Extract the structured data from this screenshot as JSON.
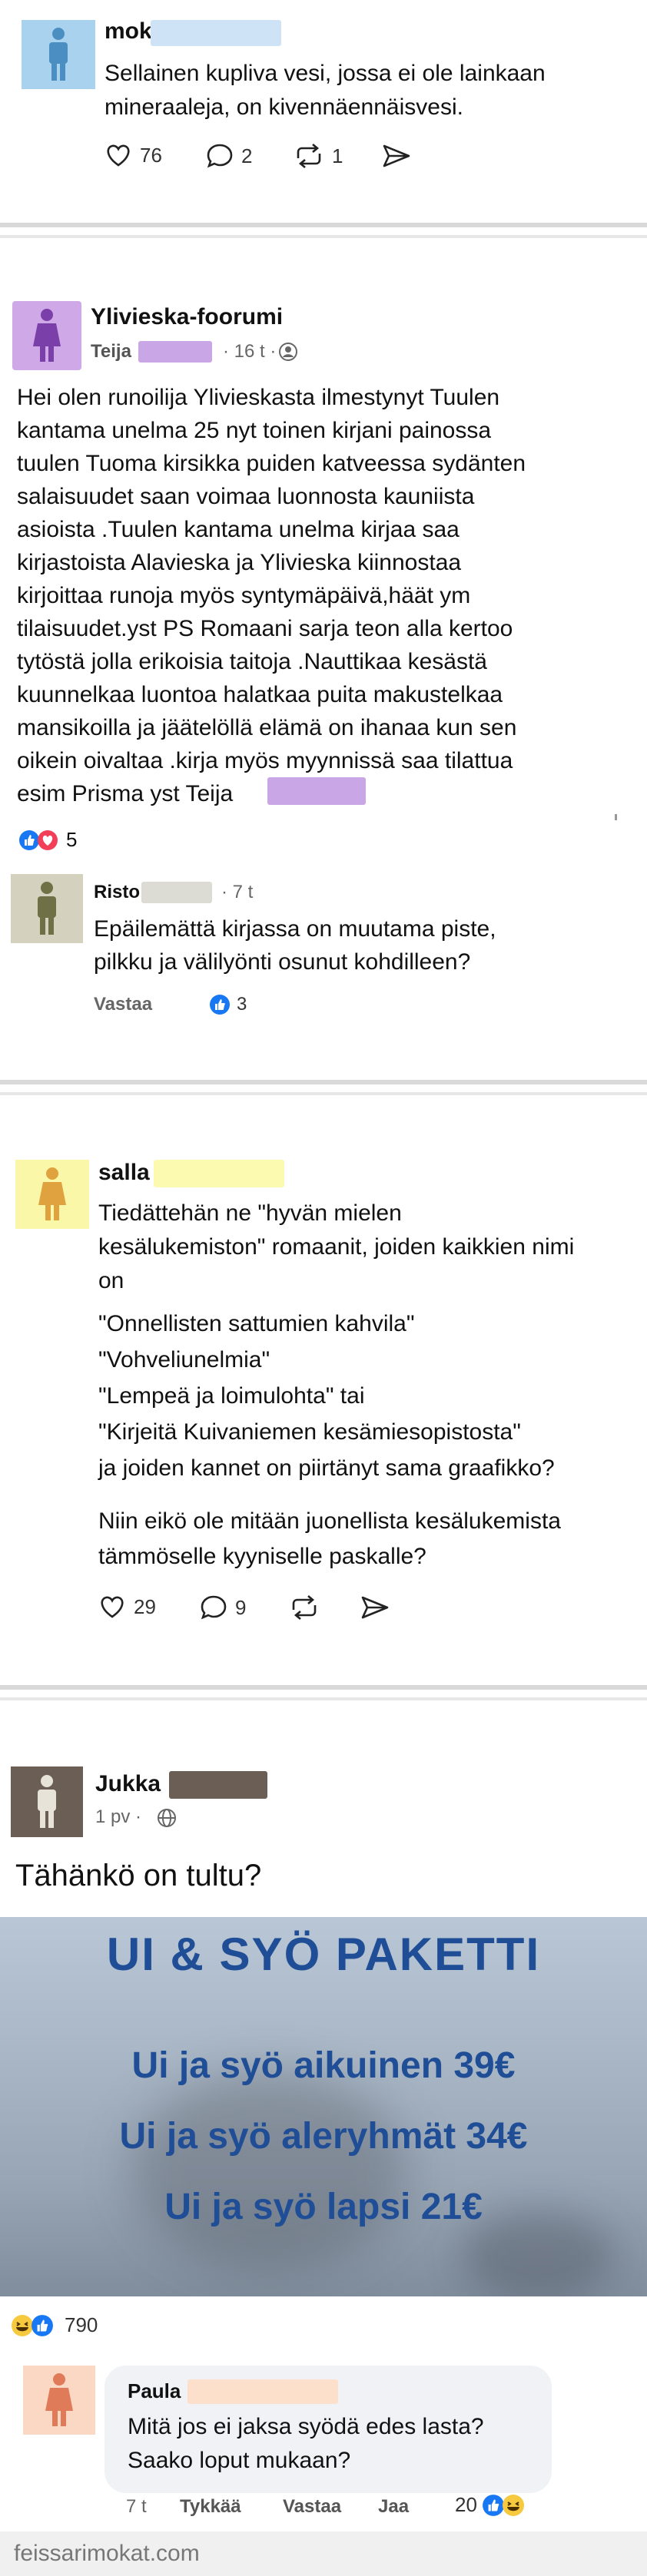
{
  "post1": {
    "user": "mok",
    "text": "Sellainen kupliva vesi, jossa ei ole lainkaan\nmineraaleja, on kivennäennäisvesi.",
    "likes": "76",
    "comments": "2",
    "reposts": "1"
  },
  "post2": {
    "group": "Ylivieska-foorumi",
    "author": "Teija",
    "time": "· 16 t ·",
    "text": "Hei olen runoilija Ylivieskasta ilmestynyt Tuulen\nkantama unelma 25 nyt toinen kirjani painossa\ntuulen Tuoma kirsikka puiden katveessa sydänten\nsalaisuudet saan voimaa luonnosta kauniista\nasioista .Tuulen kantama unelma kirjaa saa\nkirjastoista Alavieska ja Ylivieska kiinnostaa\nkirjoittaa runoja myös syntymäpäivä,häät ym\ntilaisuudet.yst PS Romaani sarja teon alla kertoo\ntytöstä jolla erikoisia taitoja .Nauttikaa kesästä\nkuunnelkaa luontoa halatkaa puita makustelkaa\nmansikoilla ja jäätelöllä elämä on ihanaa kun sen\noikein oivaltaa .kirja myös myynnissä saa tilattua\nesim Prisma yst Teija",
    "reactions": "5",
    "comment": {
      "author": "Risto",
      "time": "· 7 t",
      "text": "Epäilemättä kirjassa on muutama piste,\npilkku ja välilyönti osunut kohdilleen?",
      "reply": "Vastaa",
      "likes": "3"
    }
  },
  "post3": {
    "user": "salla",
    "text": "Tiedättehän ne \"hyvän mielen\nkesälukemiston\" romaanit, joiden kaikkien nimi\non",
    "titles": [
      "\"Onnellisten sattumien kahvila\"",
      "\"Vohveliunelmia\"",
      "\"Lempeä ja loimulohta\" tai",
      "\"Kirjeitä Kuivaniemen kesämiesopistosta\""
    ],
    "after": "ja joiden kannet on piirtänyt sama graafikko?",
    "question": "Niin eikö ole mitään juonellista kesälukemista\ntämmöselle kyyniselle paskalle?",
    "likes": "29",
    "comments": "9"
  },
  "post4": {
    "author": "Jukka",
    "time": "1 pv ·",
    "text": "Tähänkö on tultu?",
    "sign": {
      "title": "UI & SYÖ PAKETTI",
      "lines": [
        "Ui ja syö aikuinen 39€",
        "Ui ja syö aleryhmät 34€",
        "Ui ja syö lapsi 21€"
      ]
    },
    "reactions": "790",
    "comment": {
      "author": "Paula",
      "text": "Mitä jos ei jaksa syödä edes lasta?\nSaako loput mukaan?",
      "time": "7 t",
      "like": "Tykkää",
      "reply": "Vastaa",
      "share": "Jaa",
      "reactions": "20"
    }
  },
  "footer": "feissarimokat.com"
}
